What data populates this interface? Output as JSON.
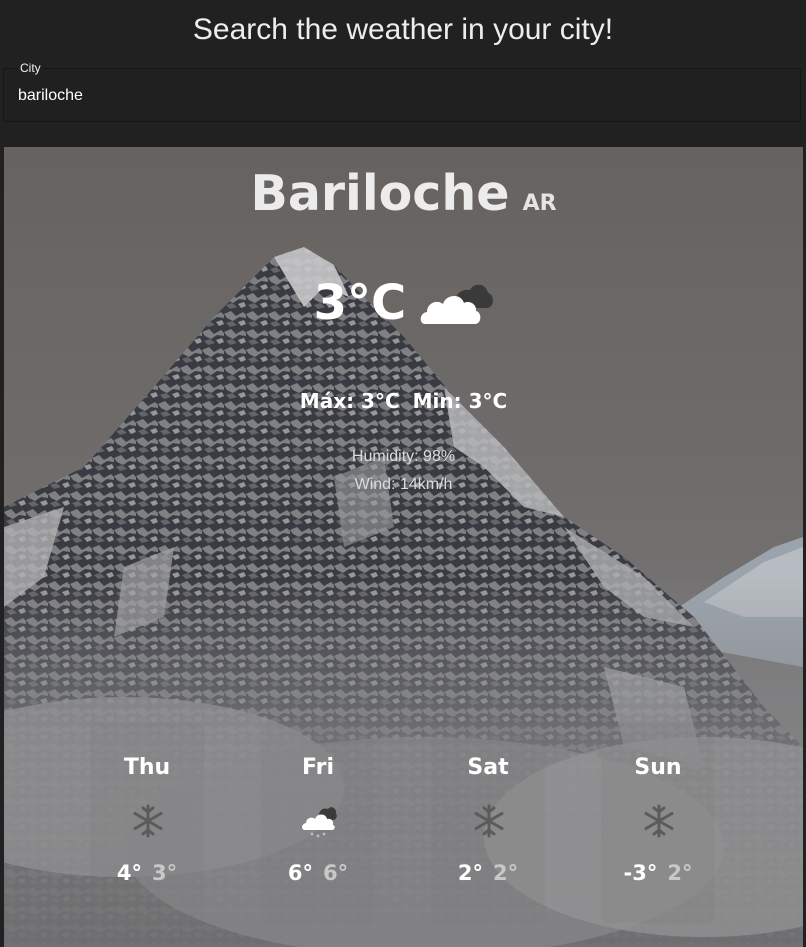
{
  "header": {
    "title": "Search the weather in your city!"
  },
  "search": {
    "label": "City",
    "value": "bariloche"
  },
  "weather": {
    "city": "Bariloche",
    "country": "AR",
    "current_temp": "3°C",
    "current_icon": "partly-cloudy-icon",
    "max": "Máx: 3°C",
    "min": "Min: 3°C",
    "humidity": "Humidity: 98%",
    "wind": "Wind: 14km/h"
  },
  "forecast": [
    {
      "day": "Thu",
      "icon": "snowflake-icon",
      "max": "4°",
      "min": "3°"
    },
    {
      "day": "Fri",
      "icon": "cloud-rain-icon",
      "max": "6°",
      "min": "6°"
    },
    {
      "day": "Sat",
      "icon": "snowflake-icon",
      "max": "2°",
      "min": "2°"
    },
    {
      "day": "Sun",
      "icon": "snowflake-icon",
      "max": "-3°",
      "min": "2°"
    }
  ],
  "colors": {
    "page_background": "#212121",
    "text": "#ffffff",
    "min_temp": "#c8c8c8"
  }
}
